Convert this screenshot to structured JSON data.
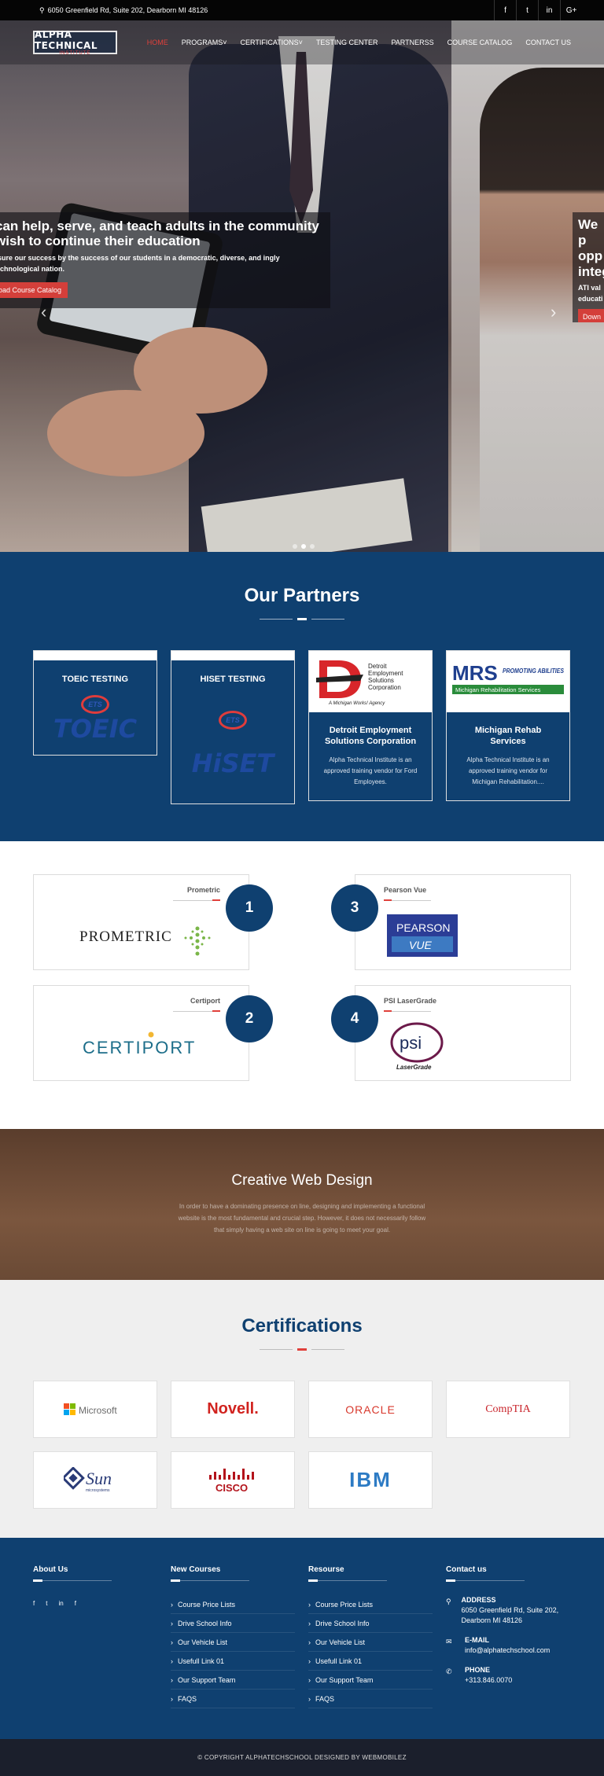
{
  "topbar": {
    "address": "6050 Greenfield Rd, Suite 202, Dearborn MI 48126",
    "socials": [
      "f",
      "t",
      "in",
      "G+"
    ]
  },
  "nav": {
    "logo_line1": "ALPHA TECHNICAL",
    "logo_line2": "INSTITUTE",
    "items": [
      "HOME",
      "PROGRAMS",
      "CERTIFICATIONS",
      "TESTING CENTER",
      "PARTNERSS",
      "COURSE CATALOG",
      "CONTACT US"
    ]
  },
  "hero": {
    "slide1_title": "can help, serve, and teach adults in the community wish to continue their education",
    "slide1_text": "ssure our success by the success of our students in a democratic, diverse, and ingly technological nation.",
    "slide1_button": "oad Course Catalog",
    "slide2_title": "We p opp integ",
    "slide2_text": "ATI val educati",
    "slide2_button": "Down"
  },
  "partners": {
    "title": "Our Partners",
    "cards": [
      {
        "title": "TOEIC TESTING",
        "brand": "TOEIC",
        "mark": "ETS"
      },
      {
        "title": "HISET TESTING",
        "brand": "HiSET",
        "mark": "ETS"
      },
      {
        "name": "Detroit Employment Solutions Corporation",
        "text": "Alpha Technical Institute is an approved training vendor for Ford Employees.",
        "logo_line1": "Detroit",
        "logo_line2": "Employment",
        "logo_line3": "Solutions",
        "logo_line4": "Corporation",
        "logo_tag": "A Michigan Works! Agency"
      },
      {
        "name": "Michigan Rehab Services",
        "text": "Alpha Technical Institute is an approved training vendor for Michigan Rehabilitation....",
        "logo_line1": "MRS",
        "logo_line2": "PROMOTING ABILITIES",
        "logo_line3": "Michigan Rehabilitation Services"
      }
    ]
  },
  "testing_centers": [
    {
      "number": "1",
      "name": "Prometric",
      "logo": "PROMETRIC"
    },
    {
      "number": "2",
      "name": "Certiport",
      "logo": "CERTIPORT"
    },
    {
      "number": "3",
      "name": "Pearson Vue",
      "logo_line1": "PEARSON",
      "logo_line2": "VUE"
    },
    {
      "number": "4",
      "name": "PSI LaserGrade",
      "logo_line1": "psi",
      "logo_line2": "LaserGrade"
    }
  ],
  "cwd": {
    "title": "Creative Web Design",
    "text": "In order to have a dominating presence on line, designing and implementing a functional website is the most fundamental and crucial step. However, it does not necessarily follow that simply having a web site on line is going to meet your goal."
  },
  "certifications": {
    "title": "Certifications",
    "logos": [
      "Microsoft",
      "Novell.",
      "ORACLE",
      "CompTIA",
      "Sun",
      "CISCO",
      "IBM"
    ],
    "sun_sub": "microsystems"
  },
  "footer": {
    "about": {
      "title": "About Us",
      "socials": [
        "f",
        "t",
        "in",
        "f"
      ]
    },
    "new_courses": {
      "title": "New Courses",
      "links": [
        "Course Price Lists",
        "Drive School Info",
        "Our Vehicle List",
        "Usefull Link 01",
        "Our Support Team",
        "FAQS"
      ]
    },
    "resource": {
      "title": "Resourse",
      "links": [
        "Course Price Lists",
        "Drive School Info",
        "Our Vehicle List",
        "Usefull Link 01",
        "Our Support Team",
        "FAQS"
      ]
    },
    "contact": {
      "title": "Contact us",
      "address_label": "ADDRESS",
      "address": "6050 Greenfield Rd, Suite 202, Dearborn MI 48126",
      "email_label": "E-MAIL",
      "email": "info@alphatechschool.com",
      "phone_label": "PHONE",
      "phone": "+313.846.0070"
    }
  },
  "copyright": "© COPYRIGHT ALPHATECHSCHOOL DESIGNED BY WEBMOBILEZ",
  "colors": {
    "navy": "#0f4070",
    "accent_red": "#e0403b",
    "dark": "#1b1f2c"
  }
}
